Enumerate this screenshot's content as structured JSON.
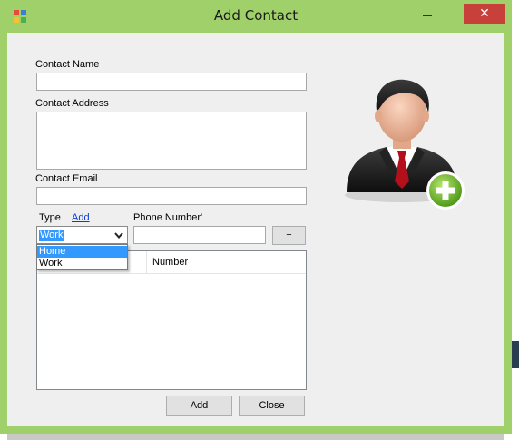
{
  "window": {
    "title": "Add Contact",
    "close_glyph": "✕",
    "accent_color": "#9fd06a",
    "close_color": "#c7403a"
  },
  "form": {
    "name_label": "Contact Name",
    "name_value": "",
    "address_label": "Contact Address",
    "address_value": "",
    "email_label": "Contact Email",
    "email_value": "",
    "type_label": "Type",
    "add_link": "Add",
    "phone_label": "Phone Number'",
    "phone_value": "",
    "plus_button": "+"
  },
  "type_combo": {
    "selected": "Work",
    "options": [
      "Home",
      "Work"
    ],
    "highlighted_option": "Home"
  },
  "phone_list": {
    "columns": [
      "",
      "Number"
    ],
    "rows": []
  },
  "buttons": {
    "add": "Add",
    "close": "Close"
  },
  "icons": {
    "app": "app-icon",
    "avatar": "contact-add-avatar-icon",
    "dropdown": "chevron-down-icon"
  }
}
